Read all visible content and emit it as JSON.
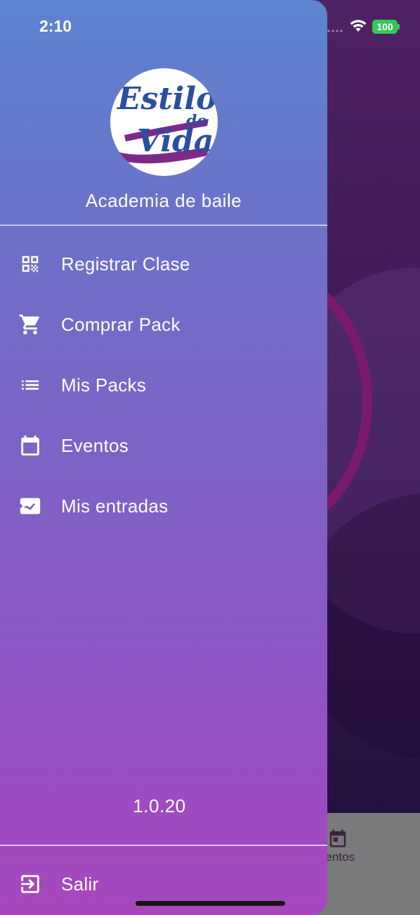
{
  "status_bar": {
    "time": "2:10",
    "battery": "100"
  },
  "drawer": {
    "logo_text_line1": "Estilo",
    "logo_text_line2": "de",
    "logo_text_line3": "Vida",
    "subtitle": "Academia de baile",
    "menu_items": [
      {
        "label": "Registrar Clase",
        "icon": "qr-code-icon"
      },
      {
        "label": "Comprar Pack",
        "icon": "cart-icon"
      },
      {
        "label": "Mis Packs",
        "icon": "list-icon"
      },
      {
        "label": "Eventos",
        "icon": "calendar-icon"
      },
      {
        "label": "Mis entradas",
        "icon": "ticket-icon"
      }
    ],
    "version": "1.0.20",
    "logout_label": "Salir"
  },
  "background": {
    "bottom_nav_label": "ventos"
  },
  "colors": {
    "drawer_top": "#5d84cf",
    "drawer_bottom": "#a747bd",
    "logo_blue": "#2b4fa0",
    "logo_purple": "#7b2a8a",
    "battery": "#36c759"
  }
}
